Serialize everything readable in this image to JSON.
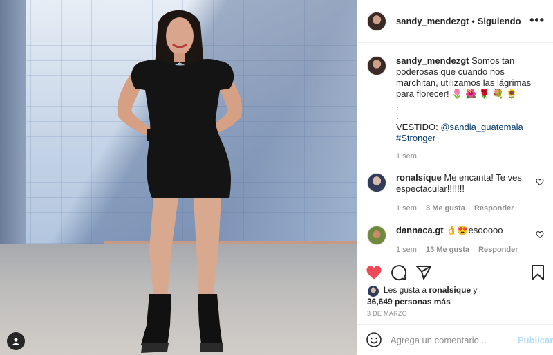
{
  "post": {
    "username": "sandy_mendezgt",
    "follow_status": "Siguiendo",
    "more_label": "•••"
  },
  "caption": {
    "username": "sandy_mendezgt",
    "text": "Somos tan poderosas que cuando nos marchitan, utilizamos las lágrimas para florecer! 🌷 🌺 🌹 💐 🌻",
    "dot1": ".",
    "dot2": ".",
    "vestido_label": "VESTIDO:",
    "mention": "@sandia_guatemala",
    "hashtag": "#Stronger",
    "time": "1 sem"
  },
  "comments": [
    {
      "username": "ronalsique",
      "text": "Me encanta! Te ves espectacular!!!!!!!",
      "time": "1 sem",
      "likes": "3 Me gusta",
      "reply": "Responder"
    },
    {
      "username": "dannaca.gt",
      "text": "👌😍esooooo",
      "time": "1 sem",
      "likes": "13 Me gusta",
      "reply": "Responder"
    }
  ],
  "likes": {
    "prefix": "Les gusta a",
    "user": "ronalsique",
    "suffix": "y",
    "count": "36,649 personas más"
  },
  "date": "3 DE MARZO",
  "add_comment": {
    "placeholder": "Agrega un comentario...",
    "publish": "Publicar"
  },
  "colors": {
    "heart_liked": "#ed4956",
    "link": "#00376b",
    "muted": "#8e8e8e",
    "publish_disabled": "#b2dffc"
  },
  "icons": [
    "heart-filled-icon",
    "comment-icon",
    "share-icon",
    "bookmark-icon",
    "emoji-icon",
    "heart-outline-icon",
    "more-icon",
    "user-tag-icon"
  ]
}
